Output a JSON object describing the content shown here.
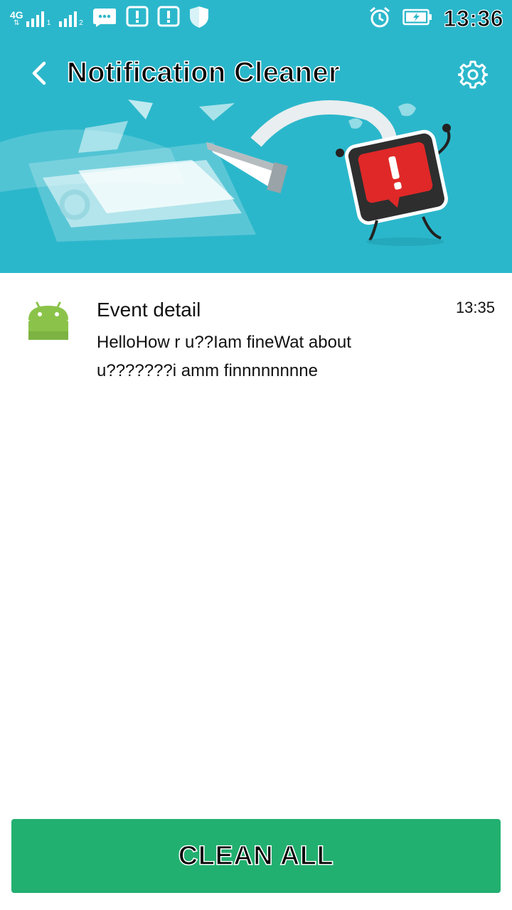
{
  "status_bar": {
    "network_type": "4G",
    "sim1_label": "1",
    "sim2_label": "2",
    "time": "13:36",
    "icons": [
      "signal-icon",
      "chat-bubble-icon",
      "alert-notification-icon",
      "alert-notification-icon",
      "shield-icon",
      "alarm-icon",
      "battery-charging-icon"
    ]
  },
  "header": {
    "title": "Notification Cleaner",
    "back_icon": "back-arrow-icon",
    "settings_icon": "gear-icon"
  },
  "notifications": [
    {
      "app_icon": "android-icon",
      "title": "Event detail",
      "body": "HelloHow r u??Iam fineWat about u???????i amm finnnnnnnne",
      "time": "13:35"
    }
  ],
  "actions": {
    "clean_all_label": "CLEAN ALL"
  },
  "colors": {
    "header_bg": "#2bb7cb",
    "button_bg": "#22b070",
    "android_green": "#8bc34a"
  }
}
